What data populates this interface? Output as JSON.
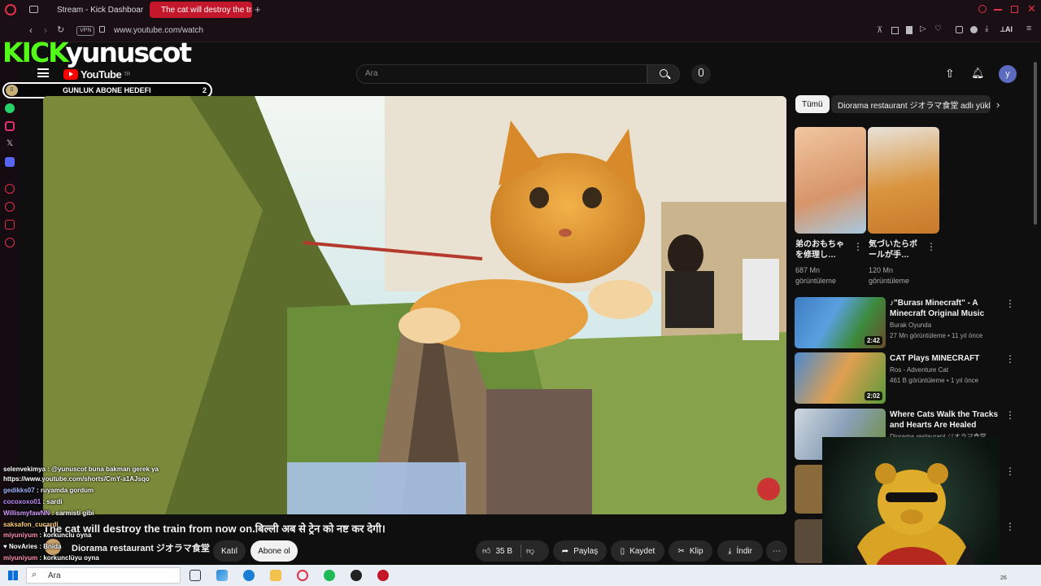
{
  "browser": {
    "tabs": [
      {
        "label": "Stream - Kick Dashboard",
        "active": false
      },
      {
        "label": "The cat will destroy the tra",
        "active": true
      }
    ],
    "url": "www.youtube.com/watch",
    "vpn_label": "VPN",
    "ai_label": "AI"
  },
  "overlay": {
    "kick_logo": "KICK",
    "streamer": "yunuscot",
    "goal_label": "GUNLUK ABONE HEDEFI",
    "goal_current": "0",
    "goal_target": "2"
  },
  "youtube": {
    "logo_text": "YouTube",
    "logo_region": "TR",
    "search_placeholder": "Ara",
    "avatar_letter": "y"
  },
  "chips": {
    "all": "Tümü",
    "channel": "Diorama restaurant ジオラマ食堂 adlı yükle"
  },
  "shorts": [
    {
      "title": "弟のおもちゃを修理し…",
      "views": "687 Mn",
      "views_label": "görüntüleme"
    },
    {
      "title": "気づいたらボールが手…",
      "views": "120 Mn",
      "views_label": "görüntüleme"
    }
  ],
  "recommendations": [
    {
      "title": "♪\"Burası Minecraft\" - A Minecraft Original Music Vide…",
      "channel": "Burak Oyunda",
      "meta": "27 Mn görüntüleme • 11 yıl önce",
      "duration": "2:42"
    },
    {
      "title": "CAT Plays MINECRAFT",
      "channel": "Ros - Adventure Cat",
      "meta": "461 B görüntüleme • 1 yıl önce",
      "duration": "2:02"
    },
    {
      "title": "Where Cats Walk the Tracks and Hearts Are Healed",
      "channel": "Diorama restaurant ジオラマ食堂",
      "meta": "",
      "duration": ""
    }
  ],
  "video": {
    "title": "The cat will destroy the train from now on.बिल्ली अब से ट्रेन को नष्ट कर देगी।",
    "channel": "Diorama restaurant ジオラマ食堂",
    "join_label": "Katıl",
    "subscribe_label": "Abone ol",
    "likes": "35 B",
    "share_label": "Paylaş",
    "save_label": "Kaydet",
    "clip_label": "Klip",
    "download_label": "İndir"
  },
  "chat": [
    {
      "user": "selenvekimya",
      "color": "#ffffff",
      "message": ": @yunuscot buna bakman gerek ya"
    },
    {
      "user": "https://www.youtube.com/shorts/CmY-a1AJsqo",
      "color": "#ffffff",
      "message": ""
    },
    {
      "user": "gedikks07",
      "color": "#9fb7ff",
      "message": ": ruyamda gordum"
    },
    {
      "user": "cocoxoxo01",
      "color": "#c58cff",
      "message": ": sardi"
    },
    {
      "user": "WillismyfawNN",
      "color": "#d59cff",
      "message": ": sarmisti gibi"
    },
    {
      "user": "saksafon_cucardi",
      "color": "#ffd27a",
      "message": ""
    },
    {
      "user": "miyuniyum",
      "color": "#ff8fb1",
      "message": ": korkunclu oyna"
    },
    {
      "user": "NovAries",
      "color": "#ffffff",
      "message": ": Bnida"
    },
    {
      "user": "miyuniyum",
      "color": "#ff8fb1",
      "message": ": korkunclüyu oyna"
    }
  ],
  "taskbar": {
    "search_placeholder": "Ara",
    "time_fragment": "26"
  },
  "colors": {
    "kick_green": "#53fc18",
    "yt_red": "#ff0000",
    "tab_active": "#c4172c"
  }
}
